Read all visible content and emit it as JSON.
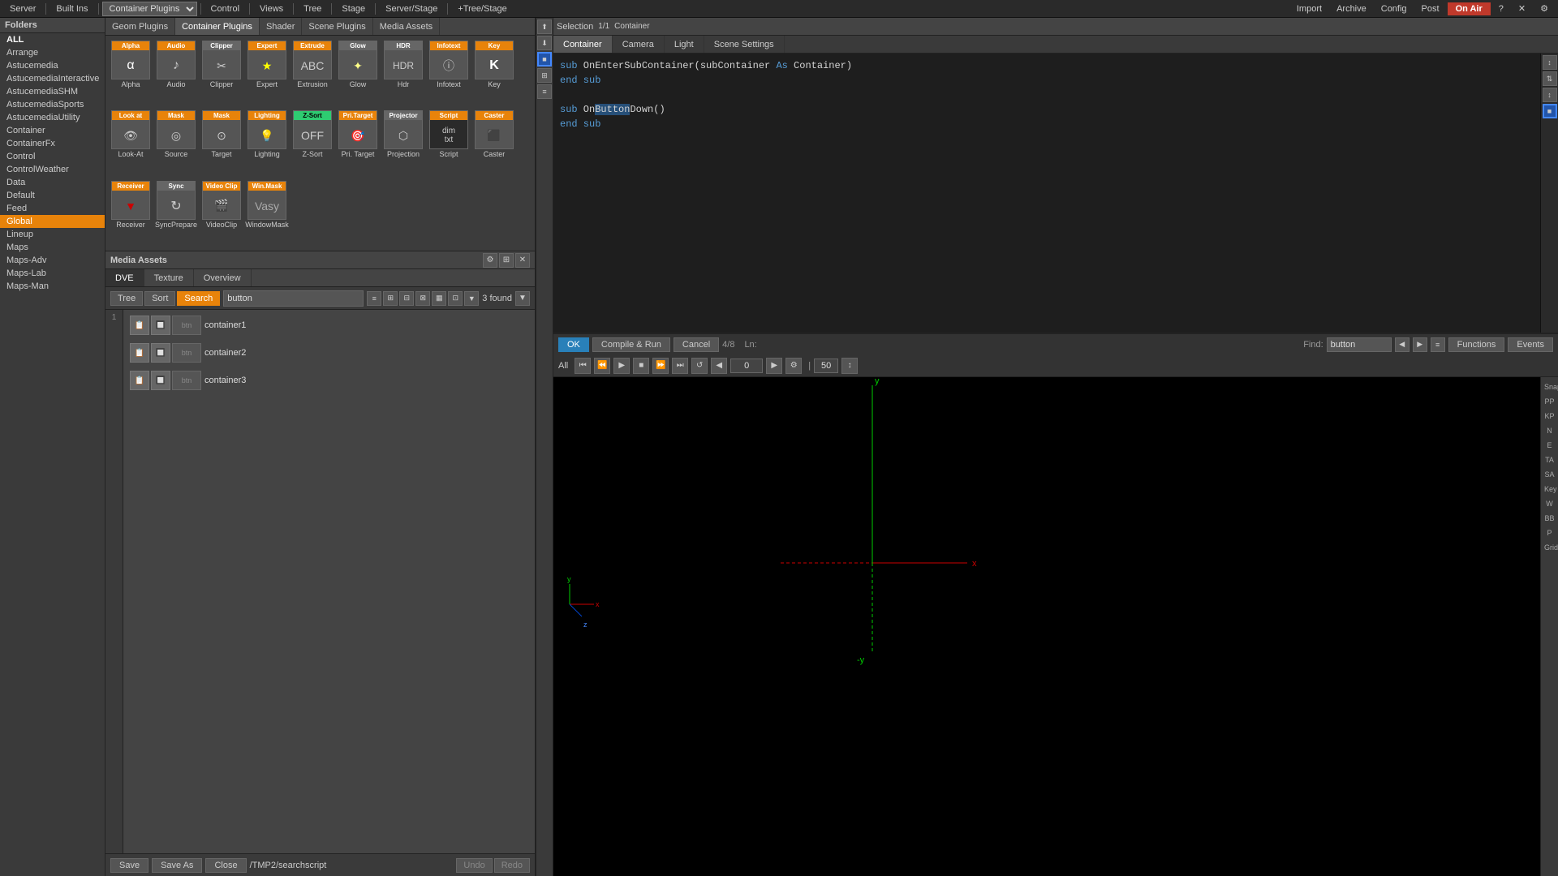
{
  "topbar": {
    "server_label": "Server",
    "builtins_label": "Built Ins",
    "control_label": "Control",
    "views_label": "Views",
    "tree_label": "Tree",
    "stage_label": "Stage",
    "server_stage_label": "Server/Stage",
    "tree_stage_label": "+Tree/Stage",
    "import_label": "Import",
    "archive_label": "Archive",
    "config_label": "Config",
    "post_label": "Post",
    "on_air_label": "On Air",
    "container_dropdown": "Container Plugins"
  },
  "folders": {
    "header": "Folders",
    "items": [
      {
        "label": "ALL",
        "type": "bold"
      },
      {
        "label": "Arrange"
      },
      {
        "label": "Astucemedia"
      },
      {
        "label": "AstucemediaInteractive"
      },
      {
        "label": "AstucemediaSHM"
      },
      {
        "label": "AstucemediaSports"
      },
      {
        "label": "AstucemediaUtility"
      },
      {
        "label": "Container"
      },
      {
        "label": "ContainerFx"
      },
      {
        "label": "Control"
      },
      {
        "label": "ControlWeather"
      },
      {
        "label": "Data"
      },
      {
        "label": "Default"
      },
      {
        "label": "Feed"
      },
      {
        "label": "Global",
        "type": "active"
      },
      {
        "label": "Lineup"
      },
      {
        "label": "Maps"
      },
      {
        "label": "Maps-Adv"
      },
      {
        "label": "Maps-Lab"
      },
      {
        "label": "Maps-Man"
      }
    ]
  },
  "plugin_tabs": [
    {
      "label": "Geom Plugins",
      "active": false
    },
    {
      "label": "Container Plugins",
      "active": true
    },
    {
      "label": "Shader",
      "active": false
    },
    {
      "label": "Scene Plugins",
      "active": false
    },
    {
      "label": "Media Assets",
      "active": false
    }
  ],
  "plugins": [
    {
      "name": "Alpha",
      "tag": "Alpha",
      "tagColor": "orange",
      "icon": "α"
    },
    {
      "name": "Audio",
      "tag": "Audio",
      "tagColor": "orange",
      "icon": "♪"
    },
    {
      "name": "Clipper",
      "tag": "Clipper",
      "tagColor": "gray",
      "icon": "✂"
    },
    {
      "name": "Expert",
      "tag": "Expert",
      "tagColor": "orange",
      "icon": "★"
    },
    {
      "name": "Extrusion",
      "tag": "Extrude",
      "tagColor": "orange",
      "icon": "E"
    },
    {
      "name": "Glow",
      "tag": "Glow",
      "tagColor": "gray",
      "icon": "✦"
    },
    {
      "name": "Hdr",
      "tag": "HDR",
      "tagColor": "gray",
      "icon": "H"
    },
    {
      "name": "Infotext",
      "tag": "Infotext",
      "tagColor": "orange",
      "icon": "i"
    },
    {
      "name": "Key",
      "tag": "Key",
      "tagColor": "orange",
      "icon": "K"
    },
    {
      "name": "Look-At",
      "tag": "Look at",
      "tagColor": "orange",
      "icon": "👁"
    },
    {
      "name": "Source",
      "tag": "Mask",
      "tagColor": "orange",
      "icon": "◎"
    },
    {
      "name": "Target",
      "tag": "Mask",
      "tagColor": "orange",
      "icon": "⊙"
    },
    {
      "name": "Lighting",
      "tag": "Lighting",
      "tagColor": "orange",
      "icon": "💡"
    },
    {
      "name": "Z-Sort",
      "tag": "Z-Sort",
      "tagColor": "green",
      "icon": "Z"
    },
    {
      "name": "Pri. Target",
      "tag": "Pri. Target",
      "tagColor": "orange",
      "icon": "🎯"
    },
    {
      "name": "Projection",
      "tag": "Projector",
      "tagColor": "gray",
      "icon": "⬡"
    },
    {
      "name": "Script",
      "tag": "Script",
      "tagColor": "orange",
      "icon": "📄"
    },
    {
      "name": "Caster",
      "tag": "Caster",
      "tagColor": "orange",
      "icon": "C"
    },
    {
      "name": "Receiver",
      "tag": "Receiver",
      "tagColor": "orange",
      "icon": "R"
    },
    {
      "name": "SyncPrepare",
      "tag": "Sync",
      "tagColor": "gray",
      "icon": "↻"
    },
    {
      "name": "VideoClip",
      "tag": "Video Clip",
      "tagColor": "orange",
      "icon": "🎬"
    },
    {
      "name": "WindowMask",
      "tag": "Win.Mask",
      "tagColor": "orange",
      "icon": "⬜"
    }
  ],
  "media_assets": {
    "title": "Media Assets",
    "tabs": [
      "DVE",
      "Texture",
      "Overview"
    ],
    "active_tab": "DVE",
    "search_tabs": [
      "Tree",
      "Sort",
      "Search"
    ],
    "active_search_tab": "Search",
    "search_placeholder": "button",
    "search_value": "button",
    "found_count": "3 found",
    "files": [
      {
        "name": "container1"
      },
      {
        "name": "container2"
      },
      {
        "name": "container3"
      }
    ]
  },
  "bottom_bar": {
    "save_label": "Save",
    "save_as_label": "Save As",
    "close_label": "Close",
    "path": "/TMP2/searchscript",
    "undo_label": "Undo",
    "redo_label": "Redo"
  },
  "right_panel": {
    "selection_label": "Selection",
    "container_info": "1/1",
    "container_label": "Container",
    "tabs": [
      "Container",
      "Camera",
      "Light",
      "Scene Settings"
    ],
    "active_tab": "Container"
  },
  "code_editor": {
    "lines": [
      "sub OnEnterSubContainer(subContainer As Container)",
      "end sub",
      "",
      "sub OnButtonDown()",
      "end sub"
    ]
  },
  "code_toolbar": {
    "ok_label": "OK",
    "compile_run_label": "Compile & Run",
    "cancel_label": "Cancel",
    "position_info": "4/8",
    "ln_label": "Ln:",
    "find_label": "Find:",
    "find_value": "button",
    "functions_label": "Functions",
    "events_label": "Events"
  },
  "playback": {
    "all_label": "All",
    "time_value": "0",
    "frame_value": "50"
  },
  "side_labels": [
    "Snap",
    "PP",
    "KP",
    "N",
    "E",
    "TA",
    "SA",
    "Key",
    "W",
    "BB",
    "P",
    "Grid"
  ]
}
